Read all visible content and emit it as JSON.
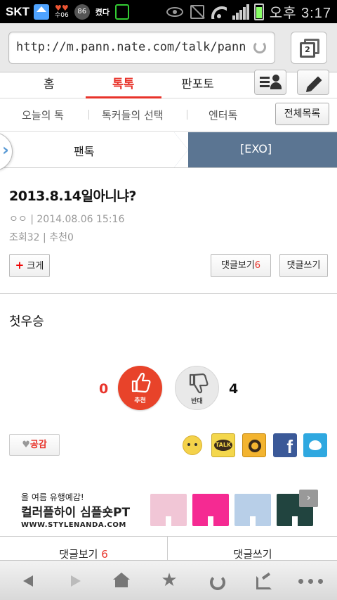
{
  "status_bar": {
    "carrier": "SKT",
    "weather_label": "수06",
    "badge_number": "86",
    "kyeo_label": "켰다",
    "time": "오후 3:17"
  },
  "browser": {
    "url": "http://m.pann.nate.com/talk/pann",
    "tab_count": "2"
  },
  "main_nav": {
    "items": [
      "홈",
      "톡톡",
      "판포토"
    ],
    "active_index": 1
  },
  "sub_nav": {
    "items": [
      "오늘의 톡",
      "톡커들의 선택",
      "엔터톡"
    ],
    "all_list_label": "전체목록"
  },
  "breadcrumb": {
    "left": "팬톡",
    "right": "[EXO]"
  },
  "article": {
    "title": "2013.8.14일아니냐?",
    "author": "ㅇㅇ",
    "date": "2014.08.06 15:16",
    "views_label": "조회32",
    "recommend_label": "추천0",
    "enlarge_label": "크게",
    "comments_view_label": "댓글보기",
    "comments_count": "6",
    "comments_write_label": "댓글쓰기",
    "body": "첫우승"
  },
  "vote": {
    "up_count": "0",
    "up_label": "추천",
    "down_count": "4",
    "down_label": "반대"
  },
  "actions": {
    "like_label": "공감",
    "kakao_talk_label": "TALK",
    "facebook_label": "f"
  },
  "ad": {
    "line1": "올 여름 유행예감!",
    "line2": "컬러플하이 심플숏PT",
    "line3": "WWW.STYLENANDA.COM"
  },
  "comment_bar": {
    "view_label": "댓글보기",
    "count": "6",
    "write_label": "댓글쓰기"
  },
  "colors": {
    "accent": "#e8332a",
    "breadcrumb_bg": "#5b7592",
    "facebook": "#3b5998",
    "twitter": "#2fa8e0"
  },
  "icons": [
    "home-icon",
    "reload-icon",
    "tabs-icon",
    "list-person-icon",
    "pencil-icon",
    "thumbs-up-icon",
    "thumbs-down-icon",
    "heart-icon",
    "emoji-icon",
    "kakao-talk-icon",
    "kakao-story-icon",
    "facebook-icon",
    "twitter-icon",
    "back-icon",
    "forward-icon",
    "star-icon",
    "share-icon",
    "more-icon"
  ]
}
